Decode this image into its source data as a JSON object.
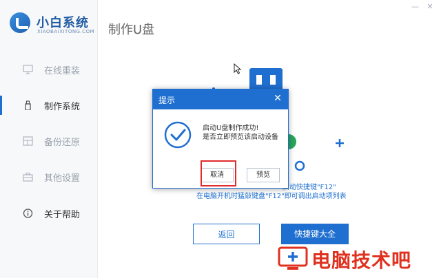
{
  "app": {
    "logo_title": "小白系统",
    "logo_subtitle": "XIAOBAIXITONG.COM",
    "page_title": "制作U盘"
  },
  "window_controls": {
    "minimize": "—",
    "close": "✕"
  },
  "sidebar": {
    "items": [
      {
        "label": "在线重装",
        "icon": "monitor-icon",
        "active": false
      },
      {
        "label": "制作系统",
        "icon": "usb-drive-icon",
        "active": true
      },
      {
        "label": "备份还原",
        "icon": "backup-restore-icon",
        "active": false
      },
      {
        "label": "其他设置",
        "icon": "briefcase-icon",
        "active": false
      },
      {
        "label": "关于帮助",
        "icon": "info-icon",
        "active": false
      }
    ]
  },
  "main": {
    "hint_line1": "启动快捷键\"F12\"",
    "hint_line2": "在电脑开机时猛敲键盘\"F12\"即可调出启动项列表",
    "back_button": "返回",
    "hotkeys_button": "快捷键大全"
  },
  "dialog": {
    "title": "提示",
    "close": "✕",
    "message_line1": "启动U盘制作成功!",
    "message_line2": "是否立即预览该启动设备",
    "cancel_button": "取消",
    "preview_button": "预览",
    "icon": "check-circle-icon"
  },
  "watermark": {
    "text": "电脑技术吧"
  },
  "colors": {
    "accent": "#1f6fd0",
    "highlight": "#e02b2b",
    "watermark": "#e0301e"
  }
}
